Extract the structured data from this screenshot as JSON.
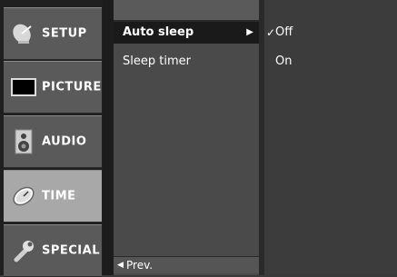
{
  "tabs": [
    {
      "label": "SETUP",
      "icon": "satellite-dish-icon",
      "active": false
    },
    {
      "label": "PICTURE",
      "icon": "tv-screen-icon",
      "active": false
    },
    {
      "label": "AUDIO",
      "icon": "speaker-icon",
      "active": false
    },
    {
      "label": "TIME",
      "icon": "clock-icon",
      "active": true
    },
    {
      "label": "SPECIAL",
      "icon": "wrench-icon",
      "active": false
    }
  ],
  "submenu": {
    "items": [
      {
        "label": "Auto sleep",
        "selected": true
      },
      {
        "label": "Sleep timer",
        "selected": false
      }
    ],
    "prev_label": "Prev."
  },
  "options": [
    {
      "label": "Off",
      "checked": true
    },
    {
      "label": "On",
      "checked": false
    }
  ],
  "glyphs": {
    "check": "✓",
    "right_arrow": "▶",
    "left_arrow": "◀"
  }
}
